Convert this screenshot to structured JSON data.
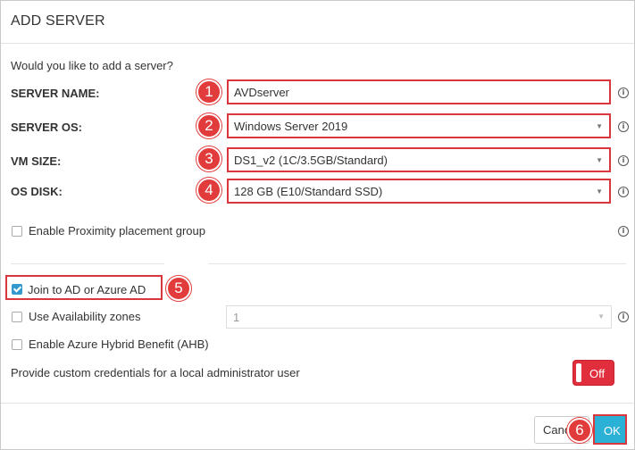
{
  "dialog": {
    "title": "ADD SERVER",
    "prompt": "Would you like to add a server?"
  },
  "form": {
    "server_name": {
      "label": "SERVER NAME:",
      "value": "AVDserver",
      "step": "1"
    },
    "server_os": {
      "label": "SERVER OS:",
      "value": "Windows Server 2019",
      "step": "2"
    },
    "vm_size": {
      "label": "VM SIZE:",
      "value": "DS1_v2 (1C/3.5GB/Standard)",
      "step": "3"
    },
    "os_disk": {
      "label": "OS DISK:",
      "value": "128 GB (E10/Standard SSD)",
      "step": "4"
    },
    "proximity": {
      "label": "Enable Proximity placement group",
      "checked": false
    },
    "join_ad": {
      "label": "Join to AD or Azure AD",
      "checked": true,
      "step": "5"
    },
    "availability": {
      "label": "Use Availability zones",
      "checked": false,
      "zone_value": "1"
    },
    "ahb": {
      "label": "Enable Azure Hybrid Benefit (AHB)",
      "checked": false
    },
    "credentials": {
      "label": "Provide custom credentials for a local administrator user",
      "toggle_label": "Off"
    }
  },
  "footer": {
    "cancel_label": "Cancel",
    "ok_label": "OK",
    "step": "6"
  },
  "icons": {
    "info": "info-icon",
    "caret": "caret-down-icon",
    "info_glyph": "i",
    "caret_glyph": "▼"
  },
  "colors": {
    "highlight": "#d9363e",
    "badge": "#e23b3b",
    "checkbox_on": "#3399cc",
    "toggle_off": "#e02e3c",
    "ok_button": "#2bb0d6"
  }
}
